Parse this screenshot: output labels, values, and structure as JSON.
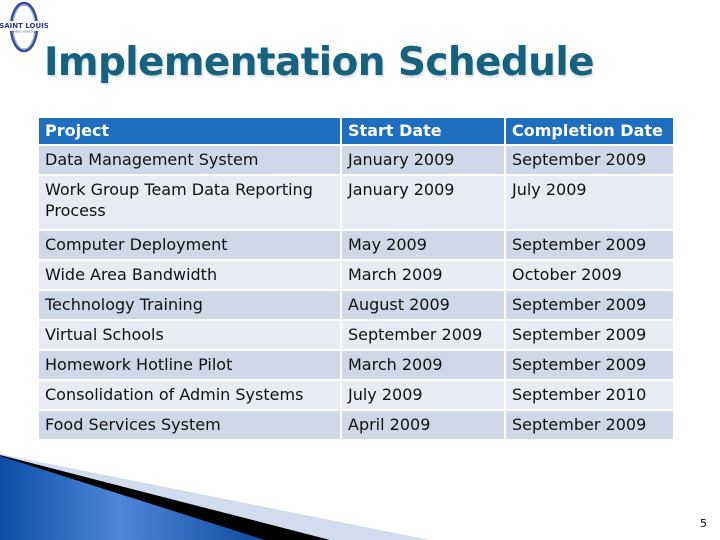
{
  "slide": {
    "logo_text": "SAINT LOUIS",
    "logo_subtext": "PUBLIC SCHOOLS",
    "title": "Implementation Schedule",
    "page_number": "5"
  },
  "table": {
    "headers": [
      "Project",
      "Start Date",
      "Completion Date"
    ],
    "rows": [
      [
        "Data Management  System",
        "January 2009",
        "September 2009"
      ],
      [
        "Work Group Team Data Reporting Process",
        "January 2009",
        "July 2009"
      ],
      [
        "Computer Deployment",
        "May 2009",
        "September 2009"
      ],
      [
        "Wide Area Bandwidth",
        "March 2009",
        "October 2009"
      ],
      [
        "Technology Training",
        "August 2009",
        "September 2009"
      ],
      [
        "Virtual Schools",
        "September 2009",
        "September 2009"
      ],
      [
        "Homework Hotline Pilot",
        "March 2009",
        "September 2009"
      ],
      [
        "Consolidation of Admin Systems",
        "July 2009",
        "September 2010"
      ],
      [
        "Food Services System",
        "April 2009",
        "September 2009"
      ]
    ]
  },
  "colors": {
    "title": "#16617e",
    "header_bg": "#1f6fc0",
    "row_dark": "#cfd7e8",
    "row_light": "#e8ebf4"
  }
}
